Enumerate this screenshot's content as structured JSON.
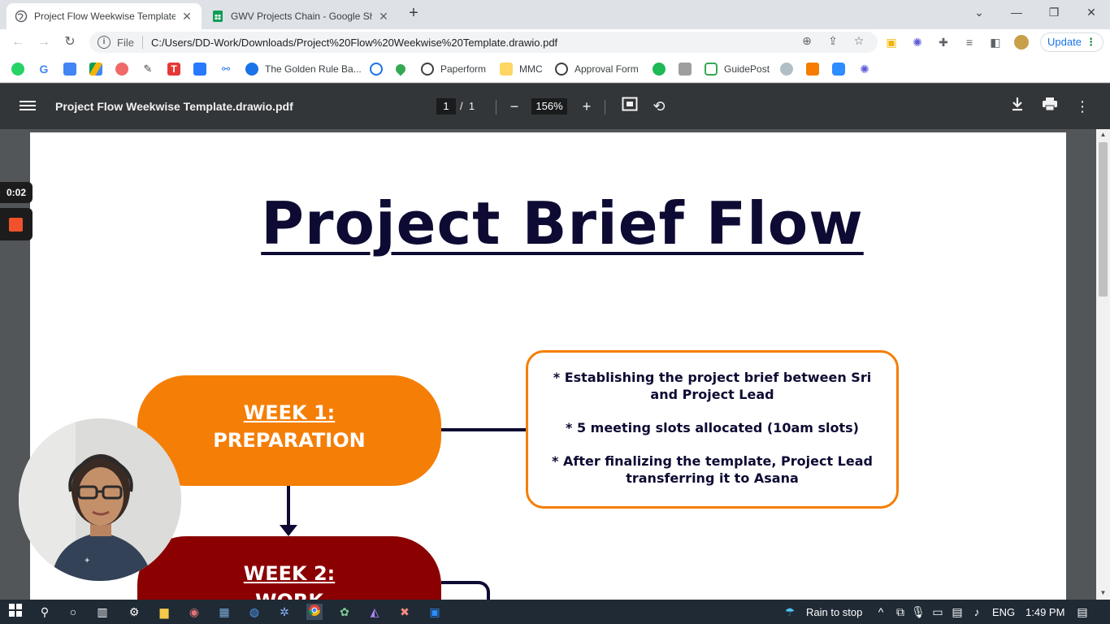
{
  "browser": {
    "tabs": [
      {
        "title": "Project Flow Weekwise Template.drawio.pdf",
        "active": true
      },
      {
        "title": "GWV Projects Chain - Google Sheets",
        "active": false
      }
    ],
    "window_controls": {
      "dropdown": "⌄",
      "minimize": "—",
      "maximize": "❐",
      "close": "✕"
    },
    "address": {
      "protocol_label": "File",
      "url": "C:/Users/DD-Work/Downloads/Project%20Flow%20Weekwise%20Template.drawio.pdf"
    },
    "update_label": "Update",
    "bookmarks": [
      {
        "label": "The Golden Rule Ba...",
        "color": "#1a73e8"
      },
      {
        "label": "Paperform",
        "color": "#3c4043"
      },
      {
        "label": "MMC",
        "color": "#fbc02d"
      },
      {
        "label": "Approval Form",
        "color": "#3c4043"
      },
      {
        "label": "GuidePost",
        "color": "#34a853"
      }
    ]
  },
  "pdf_viewer": {
    "file_title": "Project Flow Weekwise Template.drawio.pdf",
    "current_page": "1",
    "page_separator": "/",
    "total_pages": "1",
    "zoom": "156%"
  },
  "document": {
    "title": "Project Brief Flow",
    "week1": {
      "label": "WEEK 1:",
      "phase": "PREPARATION",
      "color": "#f57e07"
    },
    "week2": {
      "label": "WEEK 2:",
      "phase": "WORK",
      "color": "#8b0000"
    },
    "brief_points": [
      "* Establishing the project brief between Sri and Project Lead",
      "* 5 meeting slots allocated (10am slots)",
      "* After finalizing the template, Project Lead transferring it to Asana"
    ]
  },
  "recording": {
    "timer": "0:02"
  },
  "taskbar": {
    "weather": "Rain to stop",
    "language": "ENG",
    "time": "1:49 PM"
  }
}
